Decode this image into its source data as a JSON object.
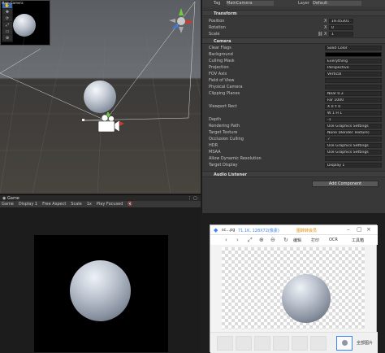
{
  "inspector": {
    "tag_label": "Tag",
    "tag_value": "MainCamera",
    "layer_label": "Layer",
    "layer_value": "Default",
    "transform_title": "Transform",
    "transform": [
      {
        "label": "Position",
        "x": "X",
        "xv": "19.45301"
      },
      {
        "label": "Rotation",
        "x": "X",
        "xv": "0"
      },
      {
        "label": "Scale",
        "x": "X",
        "xv": "1"
      }
    ],
    "camera_title": "Camera",
    "camera_props": [
      {
        "label": "Clear Flags",
        "value": "Solid Color"
      },
      {
        "label": "Background",
        "value": ""
      },
      {
        "label": "Culling Mask",
        "value": "Everything"
      },
      {
        "label": "Projection",
        "value": "Perspective"
      },
      {
        "label": "FOV Axis",
        "value": "Vertical"
      },
      {
        "label": "Field of View",
        "value": ""
      },
      {
        "label": "Physical Camera",
        "value": ""
      },
      {
        "label": "Clipping Planes",
        "value": "Near  0.3"
      },
      {
        "label": "",
        "value": "Far   1000"
      },
      {
        "label": "Viewport Rect",
        "value": "X 0     Y 0"
      },
      {
        "label": "",
        "value": "W 1     H 1"
      },
      {
        "label": "Depth",
        "value": "-1"
      },
      {
        "label": "Rendering Path",
        "value": "Use Graphics Settings"
      },
      {
        "label": "Target Texture",
        "value": "None (Render Texture)"
      },
      {
        "label": "Occlusion Culling",
        "value": "✓"
      },
      {
        "label": "HDR",
        "value": "Use Graphics Settings"
      },
      {
        "label": "MSAA",
        "value": "Use Graphics Settings"
      },
      {
        "label": "Allow Dynamic Resolution",
        "value": ""
      },
      {
        "label": "Target Display",
        "value": "Display 1"
      }
    ],
    "audio_title": "Audio Listener",
    "add_component": "Add Component"
  },
  "scene": {
    "preview_label": "Main Camera"
  },
  "game": {
    "tab_label": "Game",
    "display": "Display 1",
    "aspect": "Free Aspect",
    "scale_label": "Scale",
    "scale_value": "1x",
    "play_mode": "Play Focused"
  },
  "viewer": {
    "title": "sc...pg",
    "info": "71.1K, 128X72(像素)",
    "ai_label": "图转转会员",
    "edit_label": "编辑",
    "print_label": "打印",
    "ocr_label": "OCR",
    "tools_label": "工具箱",
    "all_images": "全部图片"
  },
  "colors": {
    "unity_panel": "#383838",
    "accent_blue": "#3a6aa8",
    "axis_red": "#d4382b",
    "axis_green": "#6fcc3a",
    "axis_blue": "#3a7be0"
  }
}
